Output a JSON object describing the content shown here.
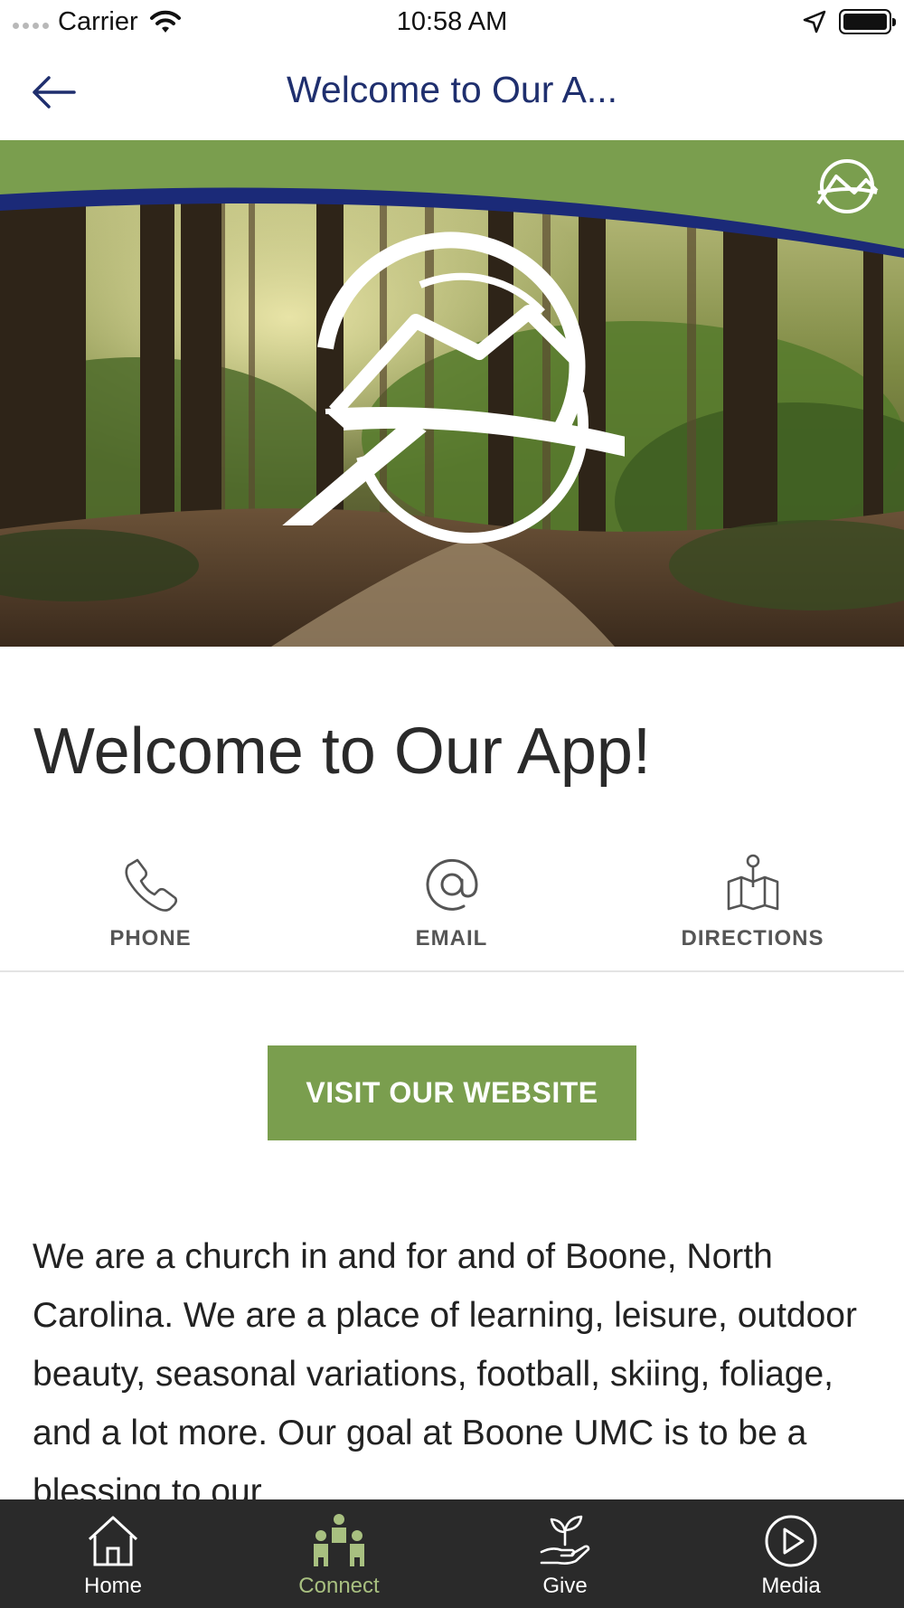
{
  "status_bar": {
    "carrier": "Carrier",
    "time": "10:58 AM"
  },
  "nav": {
    "title": "Welcome to Our A..."
  },
  "content": {
    "heading": "Welcome to Our App!",
    "actions": [
      {
        "label": "PHONE",
        "icon": "phone-icon"
      },
      {
        "label": "EMAIL",
        "icon": "at-icon"
      },
      {
        "label": "DIRECTIONS",
        "icon": "map-pin-icon"
      }
    ],
    "website_button": "VISIT OUR WEBSITE",
    "description": "We are a church in and for and of Boone, North Carolina. We are a place of learning, leisure, outdoor beauty, seasonal variations, football, skiing, foliage, and a lot more. Our goal at Boone UMC is to be a blessing to our"
  },
  "tab_bar": {
    "active": "Connect",
    "tabs": [
      {
        "label": "Home",
        "icon": "home-icon"
      },
      {
        "label": "Connect",
        "icon": "people-icon"
      },
      {
        "label": "Give",
        "icon": "hand-plant-icon"
      },
      {
        "label": "Media",
        "icon": "play-circle-icon"
      }
    ]
  },
  "colors": {
    "brand_green": "#7a9e4e",
    "brand_navy": "#1b2a78",
    "title_navy": "#1f2f6e",
    "tab_bar_bg": "#2a2a2a",
    "tab_active": "#a8c080"
  }
}
